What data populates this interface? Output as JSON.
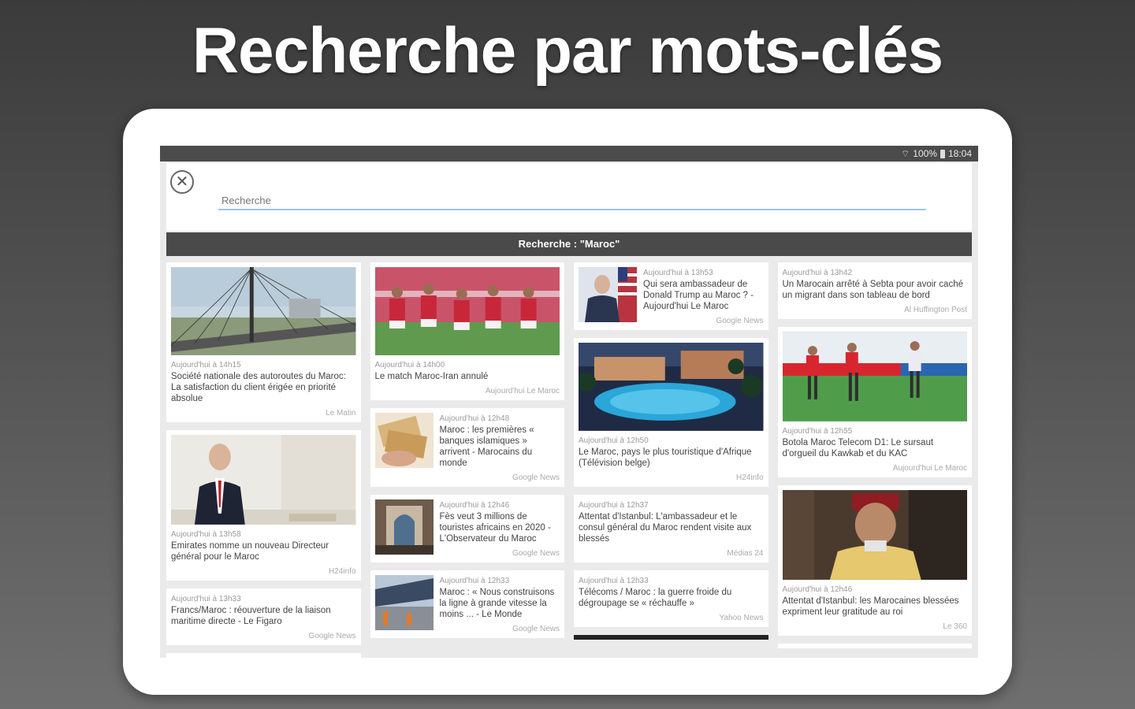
{
  "headline": "Recherche par mots-clés",
  "status": {
    "battery": "100%",
    "time": "18:04"
  },
  "search": {
    "placeholder": "Recherche",
    "result_header": "Recherche : \"Maroc\""
  },
  "columns": [
    [
      {
        "time": "Aujourd'hui à 14h15",
        "title": "Société nationale des autoroutes du Maroc: La satisfaction du client érigée en priorité absolue",
        "source": "Le Matin",
        "image": "bridge"
      },
      {
        "time": "Aujourd'hui à 13h58",
        "title": "Emirates nomme un nouveau Directeur général pour le Maroc",
        "source": "H24info",
        "image": "businessman"
      },
      {
        "time": "Aujourd'hui à 13h33",
        "title": "Francs/Maroc : réouverture de la liaison maritime directe - Le Figaro",
        "source": "Google News"
      }
    ],
    [
      {
        "time": "Aujourd'hui à 14h00",
        "title": "Le match Maroc-Iran annulé",
        "source": "Aujourd'hui Le Maroc",
        "image": "football-team"
      },
      {
        "time": "Aujourd'hui à 12h48",
        "title": "Maroc : les premières « banques islamiques » arrivent - Marocains du monde",
        "source": "Google News",
        "image": "banknotes",
        "layout": "side"
      },
      {
        "time": "Aujourd'hui à 12h46",
        "title": "Fès veut 3 millions de touristes africains en 2020 - L'Observateur du Maroc",
        "source": "Google News",
        "image": "mosque",
        "layout": "side"
      },
      {
        "time": "Aujourd'hui à 12h33",
        "title": "Maroc : « Nous construisons la ligne à grande vitesse la moins ... - Le Monde",
        "source": "Google News",
        "image": "station",
        "layout": "side"
      }
    ],
    [
      {
        "time": "Aujourd'hui à 13h53",
        "title": "Qui sera ambassadeur de Donald Trump au Maroc ? - Aujourd'hui Le Maroc",
        "source": "Google News",
        "image": "ambassador",
        "layout": "side"
      },
      {
        "time": "Aujourd'hui à 12h50",
        "title": "Le Maroc, pays le plus touristique d'Afrique (Télévision belge)",
        "source": "H24info",
        "image": "resort"
      },
      {
        "time": "Aujourd'hui à 12h37",
        "title": "Attentat d'Istanbul: L'ambassadeur et le consul général du Maroc rendent visite aux blessés",
        "source": "Médias 24"
      },
      {
        "time": "Aujourd'hui à 12h33",
        "title": "Télécoms / Maroc : la guerre froide du dégroupage se « réchauffe »",
        "source": "Yahoo News"
      }
    ],
    [
      {
        "time": "Aujourd'hui à 13h42",
        "title": "Un Marocain arrêté à Sebta pour avoir caché un migrant dans son tableau de bord",
        "source": "Al Huffington Post"
      },
      {
        "time": "Aujourd'hui à 12h55",
        "title": "Botola Maroc Telecom D1: Le sursaut d'orgueil du Kawkab et du KAC",
        "source": "Aujourd'hui Le Maroc",
        "image": "football-match"
      },
      {
        "time": "Aujourd'hui à 12h46",
        "title": "Attentat d'Istanbul: les Marocaines blessées expriment leur gratitude au roi",
        "source": "Le 360",
        "image": "king"
      }
    ]
  ]
}
